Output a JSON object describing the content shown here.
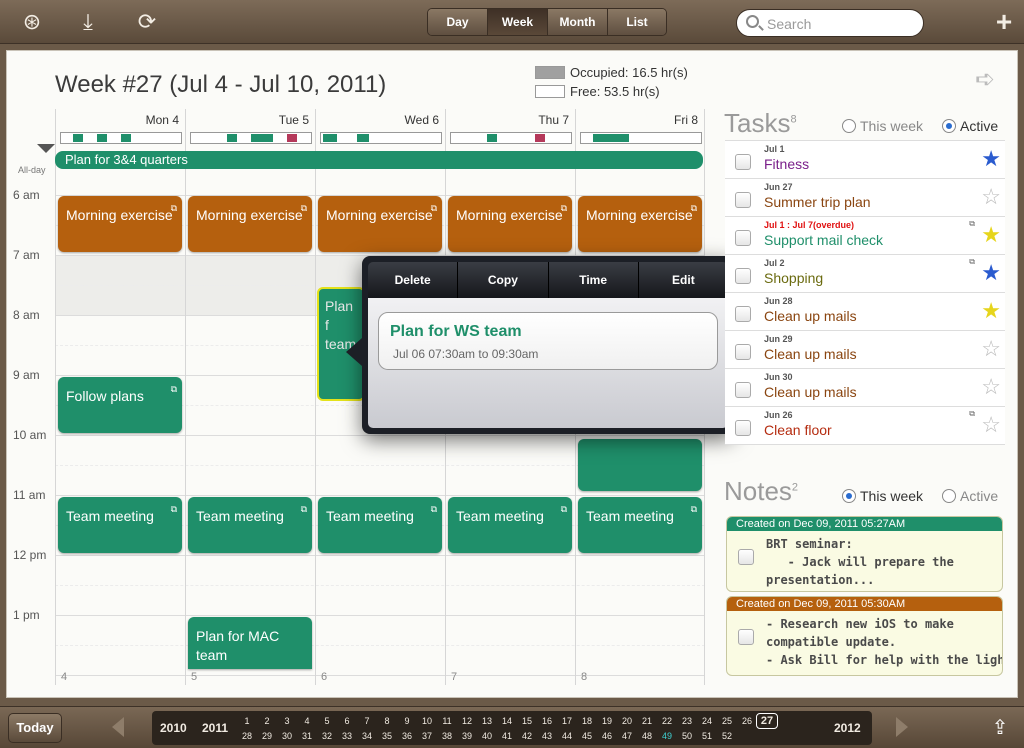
{
  "toolbar": {
    "view_tabs": [
      "Day",
      "Week",
      "Month",
      "List"
    ],
    "active_view": "Week",
    "search_placeholder": "Search",
    "add_label": "+"
  },
  "header": {
    "title": "Week #27 (Jul 4 -  Jul 10, 2011)",
    "occupied": "Occupied: 16.5 hr(s)",
    "free": "Free: 53.5 hr(s)"
  },
  "calendar": {
    "days": [
      {
        "label": "Mon 4",
        "date": "4"
      },
      {
        "label": "Tue 5",
        "date": "5"
      },
      {
        "label": "Wed 6",
        "date": "6"
      },
      {
        "label": "Thu 7",
        "date": "7"
      },
      {
        "label": "Fri 8",
        "date": "8"
      }
    ],
    "allday_label": "All-day",
    "allday_event": "Plan for 3&4 quarters",
    "times": [
      "6 am",
      "7 am",
      "8 am",
      "9 am",
      "10 am",
      "11 am",
      "12 pm",
      "1 pm"
    ],
    "events": {
      "morning": "Morning exercise",
      "follow": "Follow plans",
      "meeting": "Team meeting",
      "mac": "Plan for MAC team",
      "ws_partial": "Plan f team"
    }
  },
  "popover": {
    "actions": [
      "Delete",
      "Copy",
      "Time",
      "Edit"
    ],
    "title": "Plan for WS team",
    "time": "Jul 06 07:30am to 09:30am"
  },
  "tasks": {
    "title": "Tasks",
    "count": "8",
    "filter_week": "This week",
    "filter_active": "Active",
    "items": [
      {
        "date": "Jul 1",
        "name": "Fitness",
        "color": "#7a1f8a",
        "star": "blue"
      },
      {
        "date": "Jun 27",
        "name": "Summer trip plan",
        "color": "#8a4510",
        "star": "empty"
      },
      {
        "date": "Jul 1 : Jul 7(overdue)",
        "name": "Support mail check",
        "color": "#1f8f6a",
        "star": "yellow"
      },
      {
        "date": "Jul 2",
        "name": "Shopping",
        "color": "#6b6b10",
        "star": "blue"
      },
      {
        "date": "Jun 28",
        "name": "Clean up mails",
        "color": "#8a4510",
        "star": "yellow"
      },
      {
        "date": "Jun 29",
        "name": "Clean up mails",
        "color": "#8a4510",
        "star": "empty"
      },
      {
        "date": "Jun 30",
        "name": "Clean up mails",
        "color": "#8a4510",
        "star": "empty"
      },
      {
        "date": "Jun 26",
        "name": "Clean floor",
        "color": "#b52c10",
        "star": "empty"
      }
    ]
  },
  "notes": {
    "title": "Notes",
    "count": "2",
    "filter_week": "This week",
    "filter_active": "Active",
    "items": [
      {
        "header": "Created on  Dec 09, 2011 05:27AM",
        "color": "#1f8f6a",
        "body": "BRT seminar:\n   - Jack will prepare the\npresentation..."
      },
      {
        "header": "Created on  Dec 09, 2011 05:30AM",
        "color": "#b5600e",
        "body": "- Research new iOS to make\ncompatible update.\n- Ask Bill for help with the light."
      }
    ]
  },
  "bottom": {
    "today_label": "Today",
    "year_prev": "2010",
    "year_cur": "2011",
    "year_next": "2012",
    "weeks_top": [
      "1",
      "2",
      "3",
      "4",
      "5",
      "6",
      "7",
      "8",
      "9",
      "10",
      "11",
      "12",
      "13",
      "14",
      "15",
      "16",
      "17",
      "18",
      "19",
      "20",
      "21",
      "22",
      "23",
      "24",
      "25",
      "26",
      "27"
    ],
    "weeks_bottom": [
      "28",
      "29",
      "30",
      "31",
      "32",
      "33",
      "34",
      "35",
      "36",
      "37",
      "38",
      "39",
      "40",
      "41",
      "42",
      "43",
      "44",
      "45",
      "46",
      "47",
      "48",
      "49",
      "50",
      "51",
      "52"
    ],
    "current_week": "49",
    "selected_week": "27"
  },
  "colors": {
    "green": "#1f8f6a",
    "orange": "#b5600e",
    "occupied": "#a0a0a0"
  }
}
